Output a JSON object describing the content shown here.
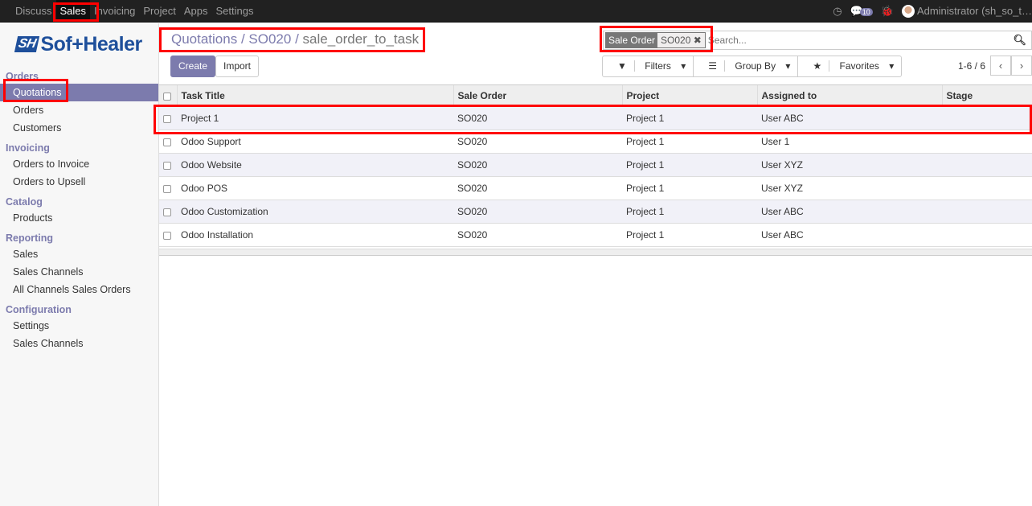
{
  "topbar": {
    "menu": [
      "Discuss",
      "Sales",
      "Invoicing",
      "Project",
      "Apps",
      "Settings"
    ],
    "active": "Sales",
    "message_count": "10",
    "user": "Administrator (sh_so_t…"
  },
  "logo": {
    "text": "SofHealer",
    "mark": "SH"
  },
  "sidebar": {
    "sections": [
      {
        "title": "Orders",
        "items": [
          "Quotations",
          "Orders",
          "Customers"
        ]
      },
      {
        "title": "Invoicing",
        "items": [
          "Orders to Invoice",
          "Orders to Upsell"
        ]
      },
      {
        "title": "Catalog",
        "items": [
          "Products"
        ]
      },
      {
        "title": "Reporting",
        "items": [
          "Sales",
          "Sales Channels",
          "All Channels Sales Orders"
        ]
      },
      {
        "title": "Configuration",
        "items": [
          "Settings",
          "Sales Channels"
        ]
      }
    ],
    "active": "Quotations"
  },
  "breadcrumb": {
    "items": [
      "Quotations",
      "SO020"
    ],
    "current": "sale_order_to_task"
  },
  "search": {
    "facet_key": "Sale Order",
    "facet_value": "SO020",
    "placeholder": "Search..."
  },
  "buttons": {
    "create": "Create",
    "import": "Import",
    "filters": "Filters",
    "group_by": "Group By",
    "favorites": "Favorites"
  },
  "pager": {
    "value": "1-6 / 6"
  },
  "table": {
    "columns": [
      "Task Title",
      "Sale Order",
      "Project",
      "Assigned to",
      "Stage"
    ],
    "rows": [
      [
        "Project 1",
        "SO020",
        "Project 1",
        "User ABC",
        ""
      ],
      [
        "Odoo Support",
        "SO020",
        "Project 1",
        "User 1",
        ""
      ],
      [
        "Odoo Website",
        "SO020",
        "Project 1",
        "User XYZ",
        ""
      ],
      [
        "Odoo POS",
        "SO020",
        "Project 1",
        "User XYZ",
        ""
      ],
      [
        "Odoo Customization",
        "SO020",
        "Project 1",
        "User ABC",
        ""
      ],
      [
        "Odoo Installation",
        "SO020",
        "Project 1",
        "User ABC",
        ""
      ]
    ]
  }
}
